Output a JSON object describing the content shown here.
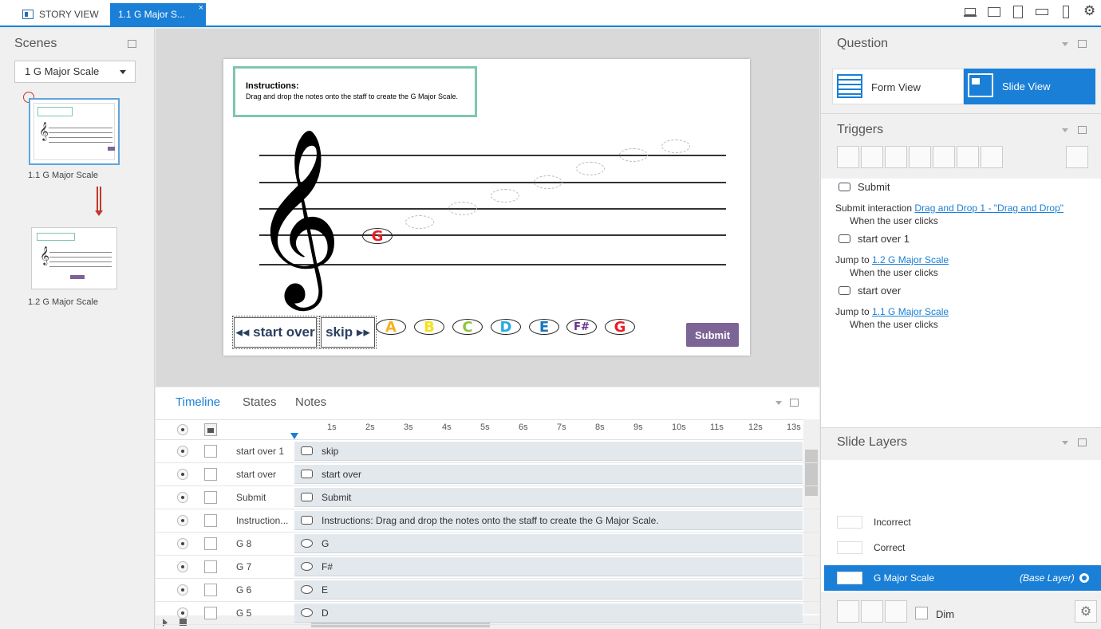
{
  "tabs": {
    "story": "STORY VIEW",
    "slide": "1.1 G Major S...",
    "close": "×"
  },
  "scenes": {
    "title": "Scenes",
    "selected": "1 G Major Scale",
    "slides": [
      {
        "label": "1.1 G Major Scale"
      },
      {
        "label": "1.2 G Major Scale"
      }
    ]
  },
  "slide": {
    "instructions_title": "Instructions:",
    "instructions_text": "Drag and drop the notes onto the staff to create the G Major Scale.",
    "placed_note": "G",
    "nav_start_over": "◂◂ start over",
    "nav_skip": "skip ▸▸",
    "notes": [
      {
        "label": "A",
        "color": "#f7b21b"
      },
      {
        "label": "B",
        "color": "#f4e21a"
      },
      {
        "label": "C",
        "color": "#8cc63f"
      },
      {
        "label": "D",
        "color": "#27aae1"
      },
      {
        "label": "E",
        "color": "#1c75bc"
      },
      {
        "label": "F#",
        "color": "#662d91"
      },
      {
        "label": "G",
        "color": "#ed1c24"
      }
    ],
    "submit": "Submit"
  },
  "timeline": {
    "tabs": [
      "Timeline",
      "States",
      "Notes"
    ],
    "ticks": [
      "1s",
      "2s",
      "3s",
      "4s",
      "5s",
      "6s",
      "7s",
      "8s",
      "9s",
      "10s",
      "11s",
      "12s",
      "13s"
    ],
    "rows": [
      {
        "name": "start over 1",
        "bar": "skip"
      },
      {
        "name": "start over",
        "bar": "start over"
      },
      {
        "name": "Submit",
        "bar": "Submit"
      },
      {
        "name": "Instruction...",
        "bar": "Instructions: Drag and drop the notes onto the staff to create the G Major Scale."
      },
      {
        "name": "G 8",
        "bar": "G"
      },
      {
        "name": "G 7",
        "bar": "F#"
      },
      {
        "name": "G 6",
        "bar": "E"
      },
      {
        "name": "G 5",
        "bar": "D"
      }
    ]
  },
  "question": {
    "title": "Question",
    "form_view": "Form View",
    "slide_view": "Slide View"
  },
  "triggers": {
    "title": "Triggers",
    "items": [
      {
        "name": "Submit",
        "action": "Submit interaction",
        "target": "Drag and Drop 1 - \"Drag and Drop\"",
        "when": "When the user clicks"
      },
      {
        "name": "start over 1",
        "action": "Jump to",
        "target": "1.2 G Major Scale",
        "when": "When the user clicks"
      },
      {
        "name": "start over",
        "action": "Jump to",
        "target": "1.1 G Major Scale",
        "when": "When the user clicks"
      }
    ]
  },
  "layers": {
    "title": "Slide Layers",
    "items": [
      {
        "name": "Incorrect"
      },
      {
        "name": "Correct"
      }
    ],
    "base": {
      "name": "G Major Scale",
      "tag": "(Base Layer)"
    },
    "dim": "Dim"
  },
  "colors": {
    "accent": "#1a7fd6",
    "submit": "#7d6496",
    "instr_border": "#7fc6b0"
  }
}
